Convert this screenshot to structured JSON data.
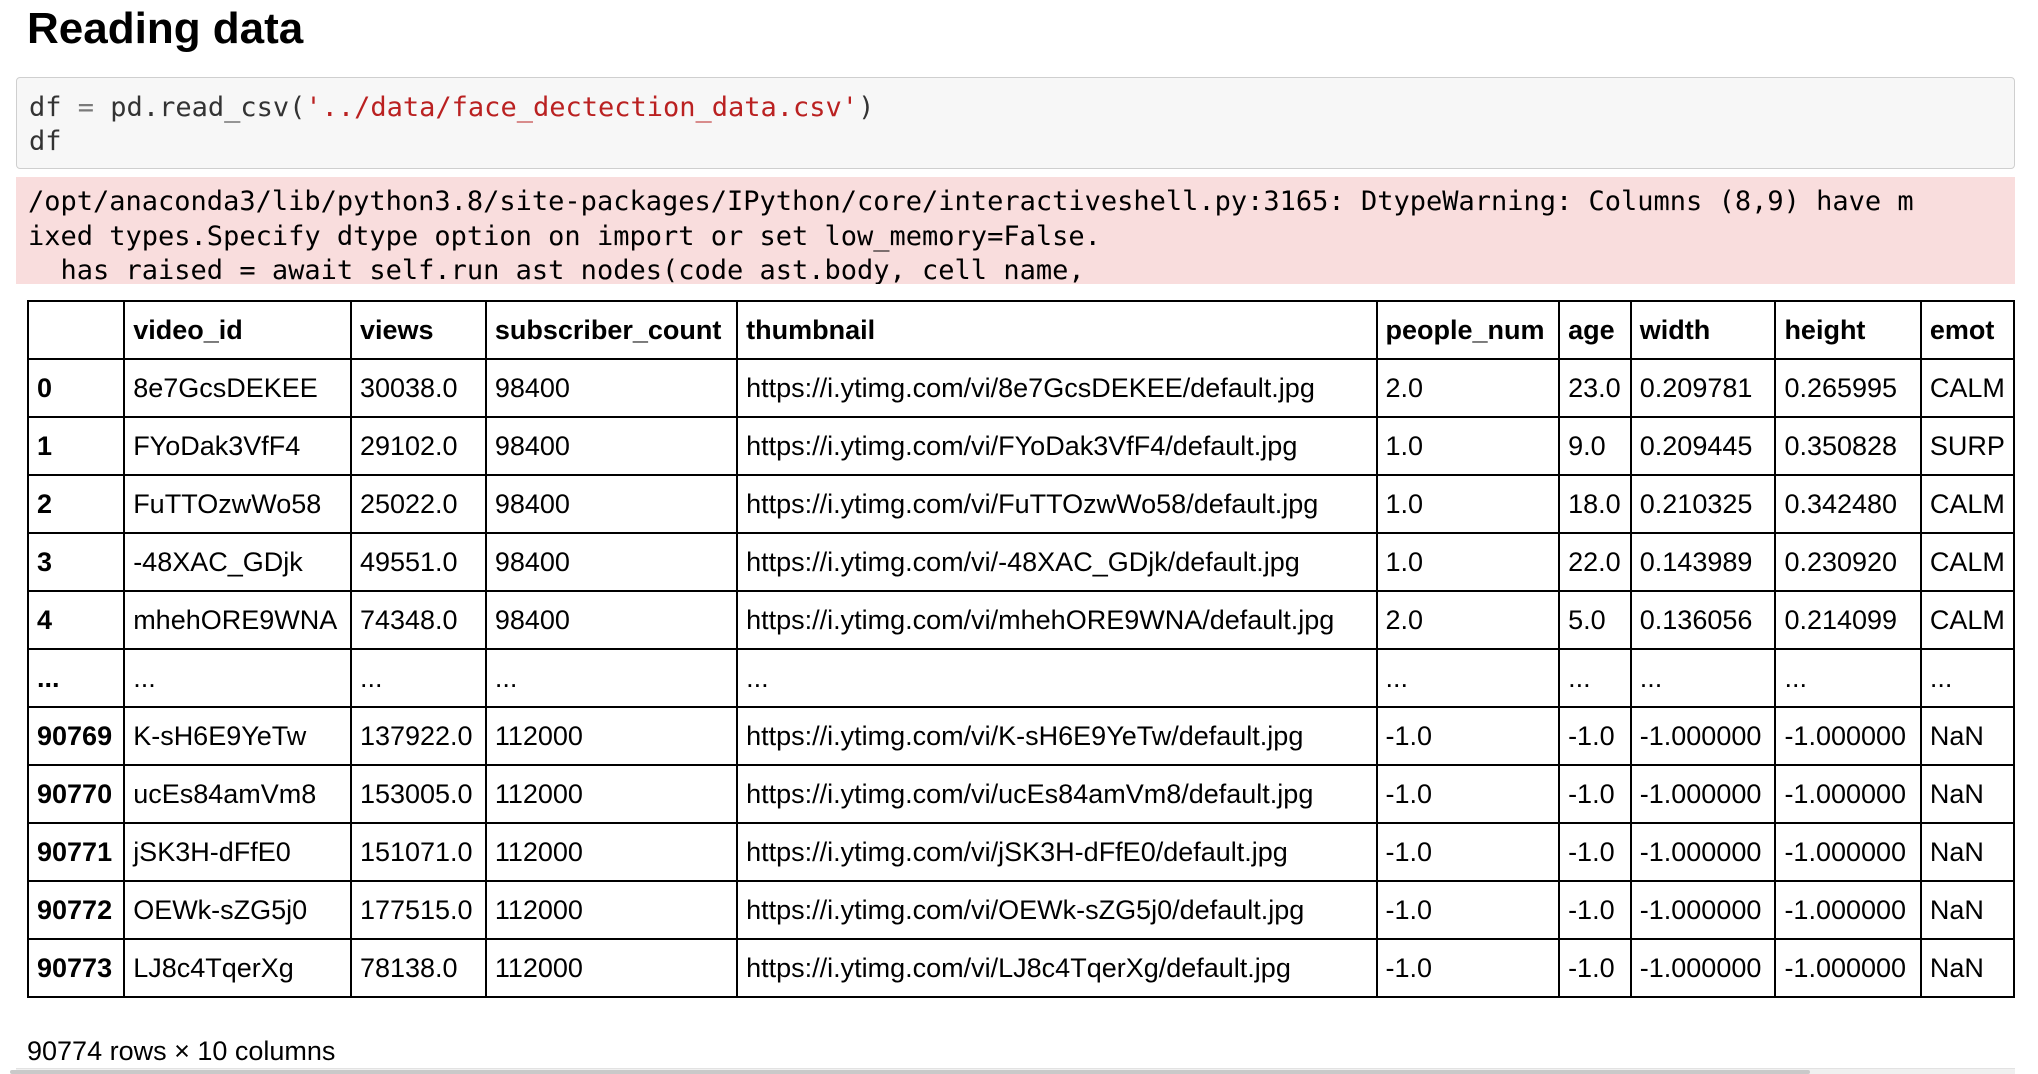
{
  "heading": "Reading data",
  "code": {
    "line1_prefix": "df ",
    "line1_op": "=",
    "line1_call": " pd.read_csv(",
    "line1_string": "'../data/face_dectection_data.csv'",
    "line1_close": ")",
    "line2": "df"
  },
  "stderr": {
    "line1": "/opt/anaconda3/lib/python3.8/site-packages/IPython/core/interactiveshell.py:3165: DtypeWarning: Columns (8,9) have m",
    "line2": "ixed types.Specify dtype option on import or set low_memory=False.",
    "line3": "  has_raised = await self.run_ast_nodes(code_ast.body, cell_name,"
  },
  "table": {
    "columns": [
      "",
      "video_id",
      "views",
      "subscriber_count",
      "thumbnail",
      "people_num",
      "age",
      "width",
      "height",
      "emot"
    ],
    "rows": [
      [
        "0",
        "8e7GcsDEKEE",
        "30038.0",
        "98400",
        "https://i.ytimg.com/vi/8e7GcsDEKEE/default.jpg",
        "2.0",
        "23.0",
        "0.209781",
        "0.265995",
        "CALM"
      ],
      [
        "1",
        "FYoDak3VfF4",
        "29102.0",
        "98400",
        "https://i.ytimg.com/vi/FYoDak3VfF4/default.jpg",
        "1.0",
        "9.0",
        "0.209445",
        "0.350828",
        "SURP"
      ],
      [
        "2",
        "FuTTOzwWo58",
        "25022.0",
        "98400",
        "https://i.ytimg.com/vi/FuTTOzwWo58/default.jpg",
        "1.0",
        "18.0",
        "0.210325",
        "0.342480",
        "CALM"
      ],
      [
        "3",
        "-48XAC_GDjk",
        "49551.0",
        "98400",
        "https://i.ytimg.com/vi/-48XAC_GDjk/default.jpg",
        "1.0",
        "22.0",
        "0.143989",
        "0.230920",
        "CALM"
      ],
      [
        "4",
        "mhehORE9WNA",
        "74348.0",
        "98400",
        "https://i.ytimg.com/vi/mhehORE9WNA/default.jpg",
        "2.0",
        "5.0",
        "0.136056",
        "0.214099",
        "CALM"
      ],
      [
        "...",
        "...",
        "...",
        "...",
        "...",
        "...",
        "...",
        "...",
        "...",
        "..."
      ],
      [
        "90769",
        "K-sH6E9YeTw",
        "137922.0",
        "112000",
        "https://i.ytimg.com/vi/K-sH6E9YeTw/default.jpg",
        "-1.0",
        "-1.0",
        "-1.000000",
        "-1.000000",
        "NaN"
      ],
      [
        "90770",
        "ucEs84amVm8",
        "153005.0",
        "112000",
        "https://i.ytimg.com/vi/ucEs84amVm8/default.jpg",
        "-1.0",
        "-1.0",
        "-1.000000",
        "-1.000000",
        "NaN"
      ],
      [
        "90771",
        "jSK3H-dFfE0",
        "151071.0",
        "112000",
        "https://i.ytimg.com/vi/jSK3H-dFfE0/default.jpg",
        "-1.0",
        "-1.0",
        "-1.000000",
        "-1.000000",
        "NaN"
      ],
      [
        "90772",
        "OEWk-sZG5j0",
        "177515.0",
        "112000",
        "https://i.ytimg.com/vi/OEWk-sZG5j0/default.jpg",
        "-1.0",
        "-1.0",
        "-1.000000",
        "-1.000000",
        "NaN"
      ],
      [
        "90773",
        "LJ8c4TqerXg",
        "78138.0",
        "112000",
        "https://i.ytimg.com/vi/LJ8c4TqerXg/default.jpg",
        "-1.0",
        "-1.0",
        "-1.000000",
        "-1.000000",
        "NaN"
      ]
    ]
  },
  "footer": "90774 rows × 10 columns"
}
